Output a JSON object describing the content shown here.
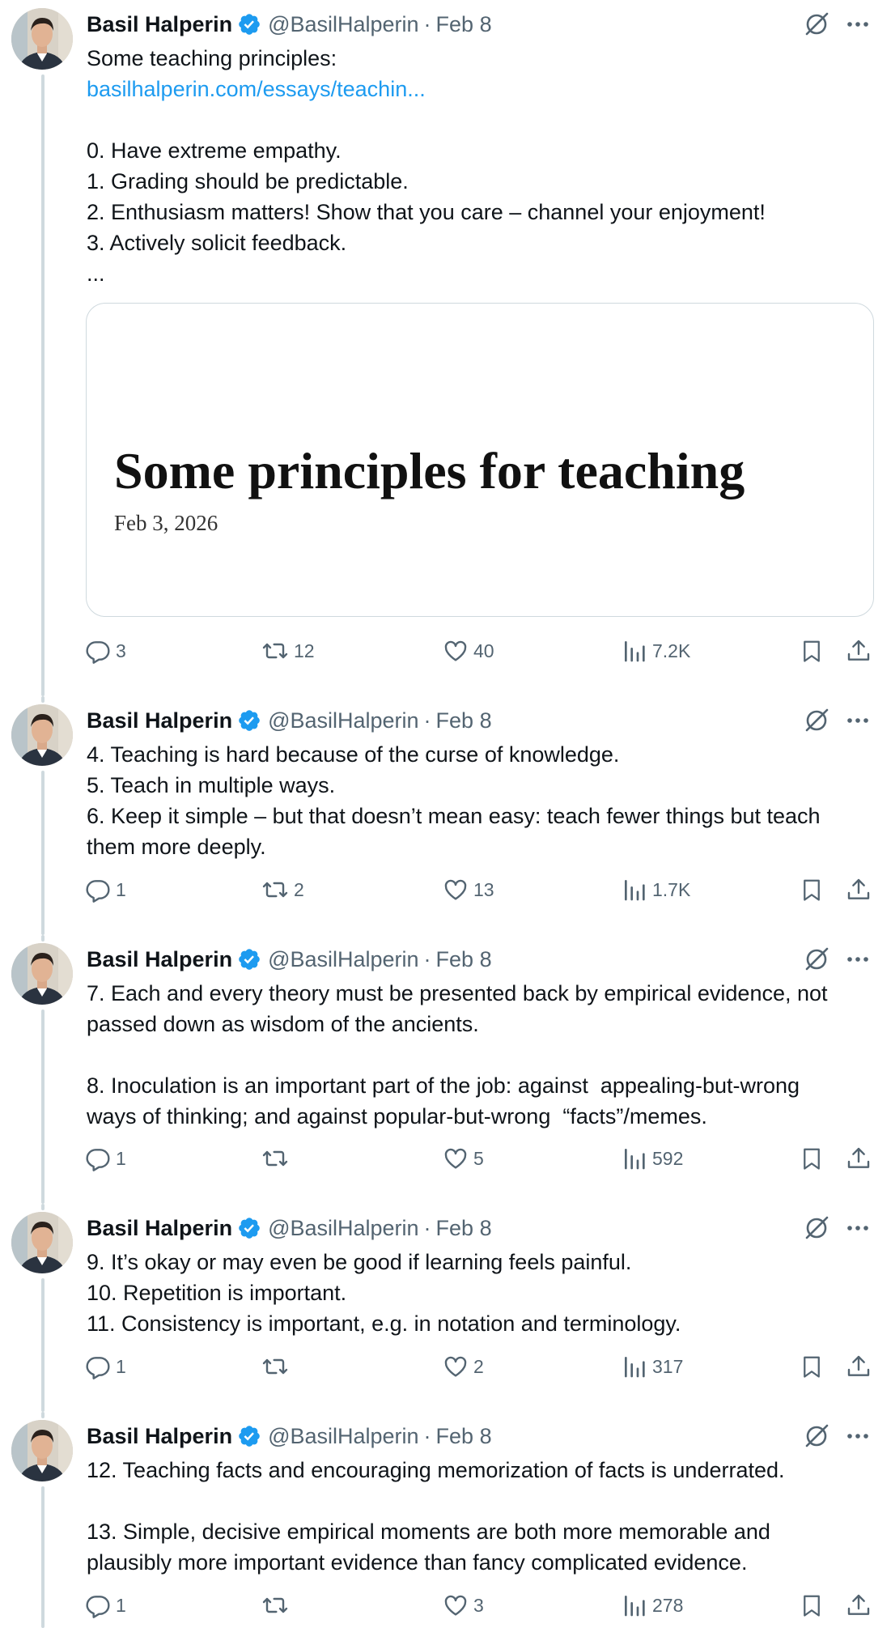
{
  "author": {
    "name": "Basil Halperin",
    "handle": "@BasilHalperin",
    "date": "Feb 8",
    "separator": "·"
  },
  "icons": {
    "verified": "verified-badge-icon",
    "grok": "grok-icon",
    "more": "more-icon",
    "reply": "reply-icon",
    "retweet": "retweet-icon",
    "like": "heart-icon",
    "views": "views-chart-icon",
    "bookmark": "bookmark-icon",
    "share": "share-icon"
  },
  "colors": {
    "verified": "#1d9bf0",
    "link": "#1d9bf0",
    "muted": "#536471",
    "text": "#0f1419",
    "thread_line": "#cfd9de"
  },
  "tweets": [
    {
      "lines": [
        "Some teaching principles:",
        "basilhalperin.com/essays/teachin...",
        "",
        "0. Have extreme empathy.",
        "1. Grading should be predictable.",
        "2. Enthusiasm matters! Show that you care – channel your enjoyment!",
        "3. Actively solicit feedback.",
        "..."
      ],
      "card": {
        "title": "Some principles for teaching",
        "date": "Feb 3, 2026"
      },
      "stats": {
        "replies": "3",
        "retweets": "12",
        "likes": "40",
        "views": "7.2K"
      }
    },
    {
      "lines": [
        "4. Teaching is hard because of the curse of knowledge.",
        "5. Teach in multiple ways.",
        "6. Keep it simple – but that doesn’t mean easy: teach fewer things but teach",
        "them more deeply."
      ],
      "stats": {
        "replies": "1",
        "retweets": "2",
        "likes": "13",
        "views": "1.7K"
      }
    },
    {
      "lines": [
        "7. Each and every theory must be presented back by empirical evidence, not",
        "passed down as wisdom of the ancients.",
        "",
        "8. Inoculation is an important part of the job: against  appealing-but-wrong",
        "ways of thinking; and against popular-but-wrong  “facts”/memes."
      ],
      "stats": {
        "replies": "1",
        "retweets": "",
        "likes": "5",
        "views": "592"
      }
    },
    {
      "lines": [
        "9. It’s okay or may even be good if learning feels painful.",
        "10. Repetition is important.",
        "11. Consistency is important, e.g. in notation and terminology."
      ],
      "stats": {
        "replies": "1",
        "retweets": "",
        "likes": "2",
        "views": "317"
      }
    },
    {
      "lines": [
        "12. Teaching facts and encouraging memorization of facts is underrated.",
        "",
        "13. Simple, decisive empirical moments are both more memorable and",
        "plausibly more important evidence than fancy complicated evidence."
      ],
      "stats": {
        "replies": "1",
        "retweets": "",
        "likes": "3",
        "views": "278"
      }
    }
  ]
}
